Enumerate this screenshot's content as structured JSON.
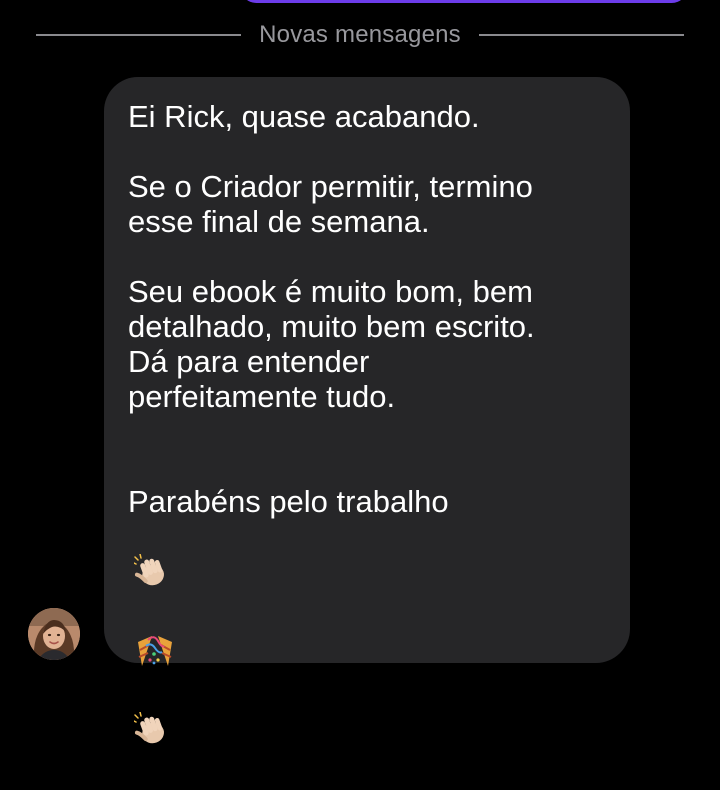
{
  "divider": {
    "label": "Novas mensagens"
  },
  "message": {
    "paragraphs": [
      "Ei Rick, quase acabando.",
      "Se o Criador permitir, termino\nesse final de semana.",
      "Seu ebook é muito bom, bem\ndetalhado, muito bem escrito.\nDá para entender\nperfeitamente tudo."
    ],
    "closing_text": "Parabéns pelo trabalho",
    "emojis": [
      "clapping-hands",
      "party-popper",
      "clapping-hands"
    ]
  },
  "colors": {
    "background": "#000000",
    "bubble": "#262628",
    "text": "#ffffff",
    "divider_text": "#98989d",
    "accent": "#6c3ce9"
  }
}
